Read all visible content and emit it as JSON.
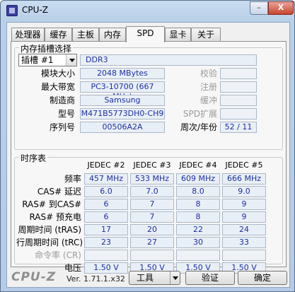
{
  "window": {
    "title": "CPU-Z",
    "minimize": "–",
    "close": "X"
  },
  "tabs": [
    "处理器",
    "缓存",
    "主板",
    "内存",
    "SPD",
    "显卡",
    "关于"
  ],
  "active_tab": "SPD",
  "slot_group": {
    "title": "内存插槽选择",
    "slot_select": "插槽 #1",
    "memory_type": "DDR3",
    "labels": {
      "module_size": "模块大小",
      "max_bandwidth": "最大带宽",
      "manufacturer": "制造商",
      "part_number": "型号",
      "serial": "序列号",
      "checksum": "校验",
      "registered": "注册",
      "buffered": "缓冲",
      "spd_ext": "SPD扩展",
      "week_year": "周次/年份"
    },
    "values": {
      "module_size": "2048 MBytes",
      "max_bandwidth": "PC3-10700 (667 MHz)",
      "manufacturer": "Samsung",
      "part_number": "M471B5773DH0-CH9",
      "serial": "00506A2A",
      "week_year": "52 / 11"
    }
  },
  "timings": {
    "title": "时序表",
    "columns": [
      "JEDEC #2",
      "JEDEC #3",
      "JEDEC #4",
      "JEDEC #5"
    ],
    "rows": [
      {
        "label": "频率",
        "values": [
          "457 MHz",
          "533 MHz",
          "609 MHz",
          "666 MHz"
        ]
      },
      {
        "label": "CAS# 延迟",
        "values": [
          "6.0",
          "7.0",
          "8.0",
          "9.0"
        ]
      },
      {
        "label": "RAS# 到CAS#",
        "values": [
          "6",
          "7",
          "8",
          "9"
        ]
      },
      {
        "label": "RAS# 预充电",
        "values": [
          "6",
          "7",
          "8",
          "9"
        ]
      },
      {
        "label": "周期时间 (tRAS)",
        "values": [
          "17",
          "20",
          "22",
          "24"
        ]
      },
      {
        "label": "行周期时间 (tRC)",
        "values": [
          "23",
          "27",
          "30",
          "33"
        ]
      },
      {
        "label": "命令率 (CR)",
        "values": [
          "",
          "",
          "",
          ""
        ],
        "disabled": true
      },
      {
        "label": "电压",
        "values": [
          "1.50 V",
          "1.50 V",
          "1.50 V",
          "1.50 V"
        ]
      }
    ]
  },
  "bottom": {
    "logo": "CPU-Z",
    "version": "Ver. 1.71.1.x32",
    "tools_button": "工具",
    "validate_button": "验证",
    "ok_button": "确定"
  }
}
